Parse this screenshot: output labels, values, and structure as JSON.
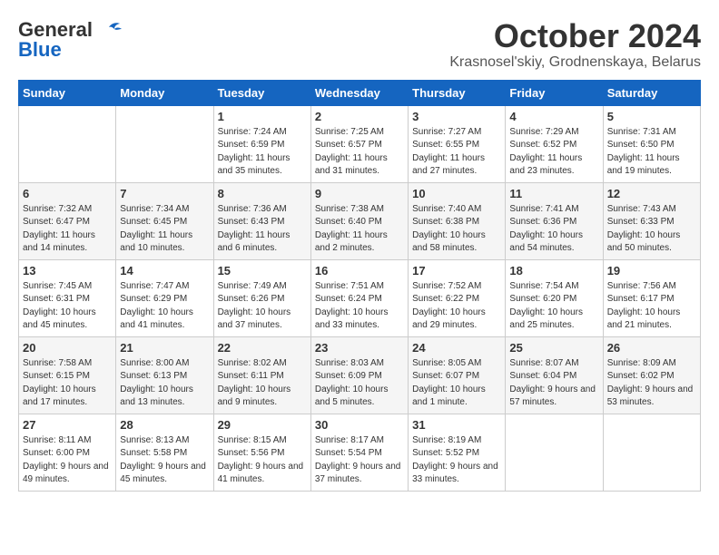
{
  "header": {
    "logo_line1": "General",
    "logo_line2": "Blue",
    "month_title": "October 2024",
    "location": "Krasnosel'skiy, Grodnenskaya, Belarus"
  },
  "weekdays": [
    "Sunday",
    "Monday",
    "Tuesday",
    "Wednesday",
    "Thursday",
    "Friday",
    "Saturday"
  ],
  "weeks": [
    [
      {
        "day": "",
        "sunrise": "",
        "sunset": "",
        "daylight": ""
      },
      {
        "day": "",
        "sunrise": "",
        "sunset": "",
        "daylight": ""
      },
      {
        "day": "1",
        "sunrise": "Sunrise: 7:24 AM",
        "sunset": "Sunset: 6:59 PM",
        "daylight": "Daylight: 11 hours and 35 minutes."
      },
      {
        "day": "2",
        "sunrise": "Sunrise: 7:25 AM",
        "sunset": "Sunset: 6:57 PM",
        "daylight": "Daylight: 11 hours and 31 minutes."
      },
      {
        "day": "3",
        "sunrise": "Sunrise: 7:27 AM",
        "sunset": "Sunset: 6:55 PM",
        "daylight": "Daylight: 11 hours and 27 minutes."
      },
      {
        "day": "4",
        "sunrise": "Sunrise: 7:29 AM",
        "sunset": "Sunset: 6:52 PM",
        "daylight": "Daylight: 11 hours and 23 minutes."
      },
      {
        "day": "5",
        "sunrise": "Sunrise: 7:31 AM",
        "sunset": "Sunset: 6:50 PM",
        "daylight": "Daylight: 11 hours and 19 minutes."
      }
    ],
    [
      {
        "day": "6",
        "sunrise": "Sunrise: 7:32 AM",
        "sunset": "Sunset: 6:47 PM",
        "daylight": "Daylight: 11 hours and 14 minutes."
      },
      {
        "day": "7",
        "sunrise": "Sunrise: 7:34 AM",
        "sunset": "Sunset: 6:45 PM",
        "daylight": "Daylight: 11 hours and 10 minutes."
      },
      {
        "day": "8",
        "sunrise": "Sunrise: 7:36 AM",
        "sunset": "Sunset: 6:43 PM",
        "daylight": "Daylight: 11 hours and 6 minutes."
      },
      {
        "day": "9",
        "sunrise": "Sunrise: 7:38 AM",
        "sunset": "Sunset: 6:40 PM",
        "daylight": "Daylight: 11 hours and 2 minutes."
      },
      {
        "day": "10",
        "sunrise": "Sunrise: 7:40 AM",
        "sunset": "Sunset: 6:38 PM",
        "daylight": "Daylight: 10 hours and 58 minutes."
      },
      {
        "day": "11",
        "sunrise": "Sunrise: 7:41 AM",
        "sunset": "Sunset: 6:36 PM",
        "daylight": "Daylight: 10 hours and 54 minutes."
      },
      {
        "day": "12",
        "sunrise": "Sunrise: 7:43 AM",
        "sunset": "Sunset: 6:33 PM",
        "daylight": "Daylight: 10 hours and 50 minutes."
      }
    ],
    [
      {
        "day": "13",
        "sunrise": "Sunrise: 7:45 AM",
        "sunset": "Sunset: 6:31 PM",
        "daylight": "Daylight: 10 hours and 45 minutes."
      },
      {
        "day": "14",
        "sunrise": "Sunrise: 7:47 AM",
        "sunset": "Sunset: 6:29 PM",
        "daylight": "Daylight: 10 hours and 41 minutes."
      },
      {
        "day": "15",
        "sunrise": "Sunrise: 7:49 AM",
        "sunset": "Sunset: 6:26 PM",
        "daylight": "Daylight: 10 hours and 37 minutes."
      },
      {
        "day": "16",
        "sunrise": "Sunrise: 7:51 AM",
        "sunset": "Sunset: 6:24 PM",
        "daylight": "Daylight: 10 hours and 33 minutes."
      },
      {
        "day": "17",
        "sunrise": "Sunrise: 7:52 AM",
        "sunset": "Sunset: 6:22 PM",
        "daylight": "Daylight: 10 hours and 29 minutes."
      },
      {
        "day": "18",
        "sunrise": "Sunrise: 7:54 AM",
        "sunset": "Sunset: 6:20 PM",
        "daylight": "Daylight: 10 hours and 25 minutes."
      },
      {
        "day": "19",
        "sunrise": "Sunrise: 7:56 AM",
        "sunset": "Sunset: 6:17 PM",
        "daylight": "Daylight: 10 hours and 21 minutes."
      }
    ],
    [
      {
        "day": "20",
        "sunrise": "Sunrise: 7:58 AM",
        "sunset": "Sunset: 6:15 PM",
        "daylight": "Daylight: 10 hours and 17 minutes."
      },
      {
        "day": "21",
        "sunrise": "Sunrise: 8:00 AM",
        "sunset": "Sunset: 6:13 PM",
        "daylight": "Daylight: 10 hours and 13 minutes."
      },
      {
        "day": "22",
        "sunrise": "Sunrise: 8:02 AM",
        "sunset": "Sunset: 6:11 PM",
        "daylight": "Daylight: 10 hours and 9 minutes."
      },
      {
        "day": "23",
        "sunrise": "Sunrise: 8:03 AM",
        "sunset": "Sunset: 6:09 PM",
        "daylight": "Daylight: 10 hours and 5 minutes."
      },
      {
        "day": "24",
        "sunrise": "Sunrise: 8:05 AM",
        "sunset": "Sunset: 6:07 PM",
        "daylight": "Daylight: 10 hours and 1 minute."
      },
      {
        "day": "25",
        "sunrise": "Sunrise: 8:07 AM",
        "sunset": "Sunset: 6:04 PM",
        "daylight": "Daylight: 9 hours and 57 minutes."
      },
      {
        "day": "26",
        "sunrise": "Sunrise: 8:09 AM",
        "sunset": "Sunset: 6:02 PM",
        "daylight": "Daylight: 9 hours and 53 minutes."
      }
    ],
    [
      {
        "day": "27",
        "sunrise": "Sunrise: 8:11 AM",
        "sunset": "Sunset: 6:00 PM",
        "daylight": "Daylight: 9 hours and 49 minutes."
      },
      {
        "day": "28",
        "sunrise": "Sunrise: 8:13 AM",
        "sunset": "Sunset: 5:58 PM",
        "daylight": "Daylight: 9 hours and 45 minutes."
      },
      {
        "day": "29",
        "sunrise": "Sunrise: 8:15 AM",
        "sunset": "Sunset: 5:56 PM",
        "daylight": "Daylight: 9 hours and 41 minutes."
      },
      {
        "day": "30",
        "sunrise": "Sunrise: 8:17 AM",
        "sunset": "Sunset: 5:54 PM",
        "daylight": "Daylight: 9 hours and 37 minutes."
      },
      {
        "day": "31",
        "sunrise": "Sunrise: 8:19 AM",
        "sunset": "Sunset: 5:52 PM",
        "daylight": "Daylight: 9 hours and 33 minutes."
      },
      {
        "day": "",
        "sunrise": "",
        "sunset": "",
        "daylight": ""
      },
      {
        "day": "",
        "sunrise": "",
        "sunset": "",
        "daylight": ""
      }
    ]
  ]
}
